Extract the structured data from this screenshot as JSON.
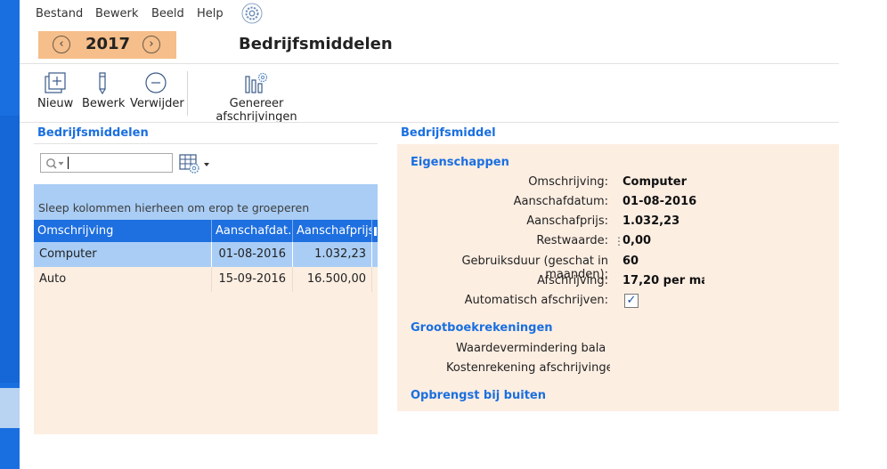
{
  "menu": {
    "items": [
      "Bestand",
      "Bewerk",
      "Beeld",
      "Help"
    ]
  },
  "year_selector": {
    "year": "2017"
  },
  "page_title": "Bedrijfsmiddelen",
  "toolbar": {
    "new_label": "Nieuw",
    "edit_label": "Bewerk",
    "delete_label": "Verwijder",
    "generate_label": "Genereer afschrijvingen"
  },
  "list_panel": {
    "title": "Bedrijfsmiddelen",
    "search": {
      "value": "",
      "placeholder": ""
    },
    "group_hint": "Sleep kolommen hierheen om erop te groeperen",
    "columns": [
      "Omschrijving",
      "Aanschafdat…",
      "Aanschafprijs"
    ],
    "rows": [
      {
        "omschrijving": "Computer",
        "aanschafdatum": "01-08-2016",
        "aanschafprijs": "1.032,23",
        "selected": true
      },
      {
        "omschrijving": "Auto",
        "aanschafdatum": "15-09-2016",
        "aanschafprijs": "16.500,00",
        "selected": false
      }
    ]
  },
  "detail_panel": {
    "title": "Bedrijfsmiddel",
    "sections": {
      "eigenschappen": "Eigenschappen",
      "grootboek": "Grootboekrekeningen",
      "opbrengst": "Opbrengst bij buiten"
    },
    "fields": {
      "omschrijving": {
        "label": "Omschrijving:",
        "value": "Computer"
      },
      "aanschafdatum": {
        "label": "Aanschafdatum:",
        "value": "01-08-2016"
      },
      "aanschafprijs": {
        "label": "Aanschafprijs:",
        "value": "1.032,23"
      },
      "restwaarde": {
        "label": "Restwaarde:",
        "value": "0,00"
      },
      "gebruiksduur": {
        "label": "Gebruiksduur (geschat in maanden):",
        "value": "60"
      },
      "afschrijving": {
        "label": "Afschrijving:",
        "value": "17,20 per ma"
      },
      "automatisch": {
        "label": "Automatisch afschrijven:",
        "checked": true
      }
    },
    "grootboek_fields": {
      "waardevermindering": "Waardevermindering balans",
      "kostenrekening": "Kostenrekening afschrijvingen:"
    }
  },
  "colors": {
    "accent_blue": "#1a6fe0",
    "selected_row": "#a9cdf5",
    "panel_bg": "#fdeee2",
    "year_box": "#f5be8a"
  }
}
